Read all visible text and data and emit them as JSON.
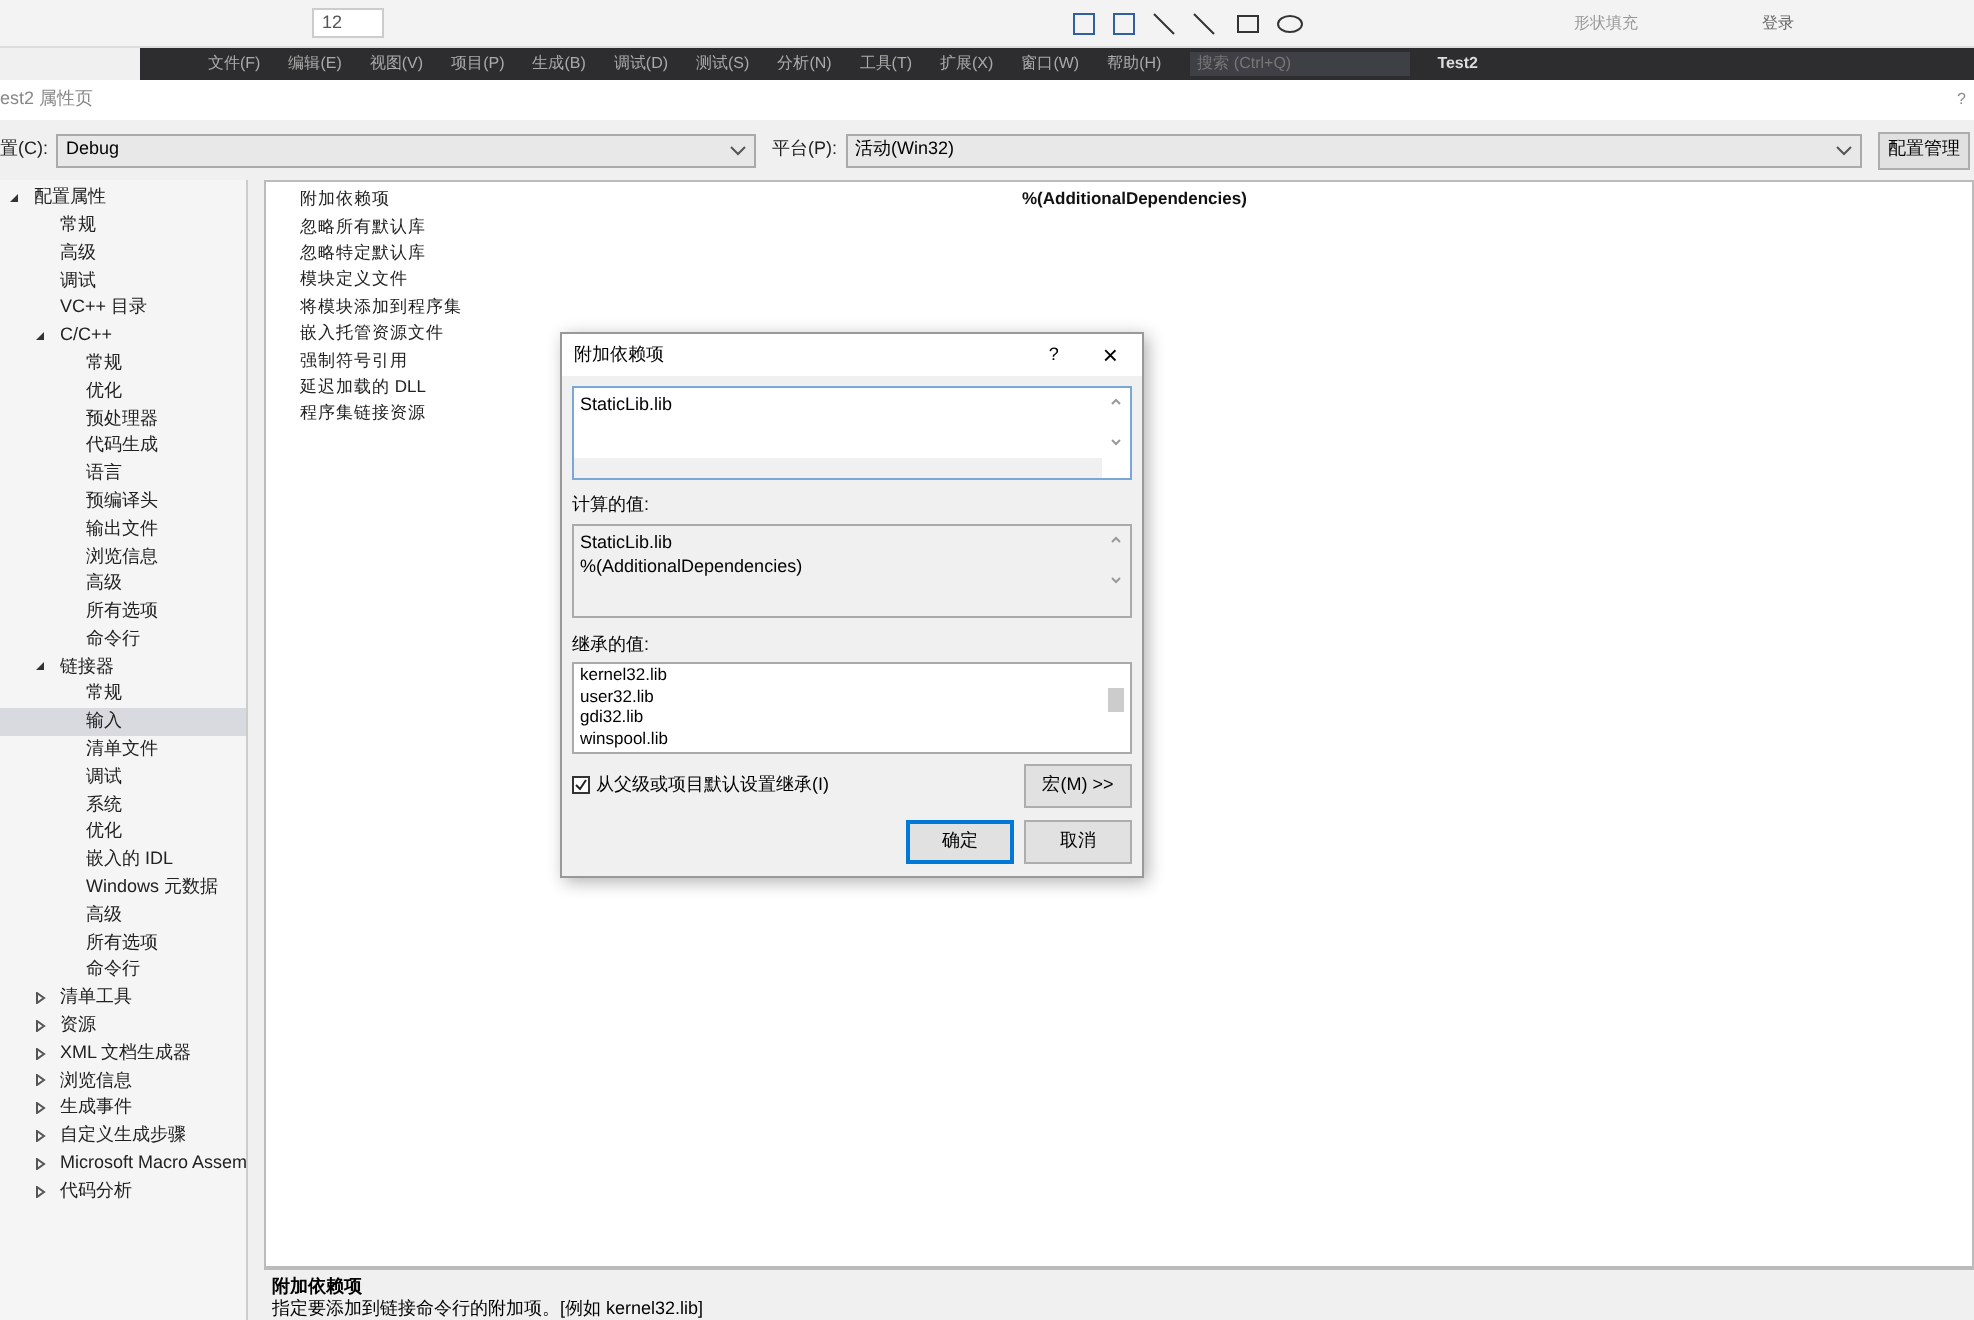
{
  "background_ribbon": {
    "font_size": "12",
    "shape_fill": "形状填充",
    "search": "登录"
  },
  "background_menu": {
    "items": [
      "文件(F)",
      "编辑(E)",
      "视图(V)",
      "项目(P)",
      "生成(B)",
      "调试(D)",
      "测试(S)",
      "分析(N)",
      "工具(T)",
      "扩展(X)",
      "窗口(W)",
      "帮助(H)"
    ],
    "search": "搜索 (Ctrl+Q)",
    "project": "Test2"
  },
  "window": {
    "title": "est2 属性页",
    "help": "?"
  },
  "config": {
    "label": "置(C):",
    "value": "Debug",
    "platform_label": "平台(P):",
    "platform_value": "活动(Win32)",
    "manager_button": "配置管理"
  },
  "tree": [
    {
      "label": "配置属性",
      "expanded": true,
      "selected": false,
      "children": [
        {
          "label": "常规",
          "selected": false
        },
        {
          "label": "高级",
          "selected": false
        },
        {
          "label": "调试",
          "selected": false
        },
        {
          "label": "VC++ 目录",
          "selected": false
        },
        {
          "label": "C/C++",
          "expanded": true,
          "selected": false,
          "children": [
            {
              "label": "常规",
              "selected": false
            },
            {
              "label": "优化",
              "selected": false
            },
            {
              "label": "预处理器",
              "selected": false
            },
            {
              "label": "代码生成",
              "selected": false
            },
            {
              "label": "语言",
              "selected": false
            },
            {
              "label": "预编译头",
              "selected": false
            },
            {
              "label": "输出文件",
              "selected": false
            },
            {
              "label": "浏览信息",
              "selected": false
            },
            {
              "label": "高级",
              "selected": false
            },
            {
              "label": "所有选项",
              "selected": false
            },
            {
              "label": "命令行",
              "selected": false
            }
          ]
        },
        {
          "label": "链接器",
          "expanded": true,
          "selected": false,
          "children": [
            {
              "label": "常规",
              "selected": false
            },
            {
              "label": "输入",
              "selected": true
            },
            {
              "label": "清单文件",
              "selected": false
            },
            {
              "label": "调试",
              "selected": false
            },
            {
              "label": "系统",
              "selected": false
            },
            {
              "label": "优化",
              "selected": false
            },
            {
              "label": "嵌入的 IDL",
              "selected": false
            },
            {
              "label": "Windows 元数据",
              "selected": false
            },
            {
              "label": "高级",
              "selected": false
            },
            {
              "label": "所有选项",
              "selected": false
            },
            {
              "label": "命令行",
              "selected": false
            }
          ]
        },
        {
          "label": "清单工具",
          "expanded": false,
          "selected": false
        },
        {
          "label": "资源",
          "expanded": false,
          "selected": false
        },
        {
          "label": "XML 文档生成器",
          "expanded": false,
          "selected": false
        },
        {
          "label": "浏览信息",
          "expanded": false,
          "selected": false
        },
        {
          "label": "生成事件",
          "expanded": false,
          "selected": false
        },
        {
          "label": "自定义生成步骤",
          "expanded": false,
          "selected": false
        },
        {
          "label": "Microsoft Macro Assem",
          "expanded": false,
          "selected": false
        },
        {
          "label": "代码分析",
          "expanded": false,
          "selected": false
        }
      ]
    }
  ],
  "properties": [
    {
      "name": "附加依赖项",
      "value": "%(AdditionalDependencies)"
    },
    {
      "name": "忽略所有默认库"
    },
    {
      "name": "忽略特定默认库"
    },
    {
      "name": "模块定义文件"
    },
    {
      "name": "将模块添加到程序集"
    },
    {
      "name": "嵌入托管资源文件"
    },
    {
      "name": "强制符号引用"
    },
    {
      "name": "延迟加载的 DLL"
    },
    {
      "name": "程序集链接资源"
    }
  ],
  "description": {
    "title": "附加依赖项",
    "text": "指定要添加到链接命令行的附加项。[例如 kernel32.lib]"
  },
  "dialog": {
    "title": "附加依赖项",
    "help": "?",
    "close": "×",
    "input_value": "StaticLib.lib",
    "computed_label": "计算的值:",
    "computed_lines": [
      "StaticLib.lib",
      "%(AdditionalDependencies)"
    ],
    "inherited_label": "继承的值:",
    "inherited_lines": [
      "kernel32.lib",
      "user32.lib",
      "gdi32.lib",
      "winspool.lib"
    ],
    "inherit_checkbox": {
      "label": "从父级或项目默认设置继承(I)",
      "checked": true
    },
    "macro_button": "宏(M) >>",
    "ok_button": "确定",
    "cancel_button": "取消"
  }
}
